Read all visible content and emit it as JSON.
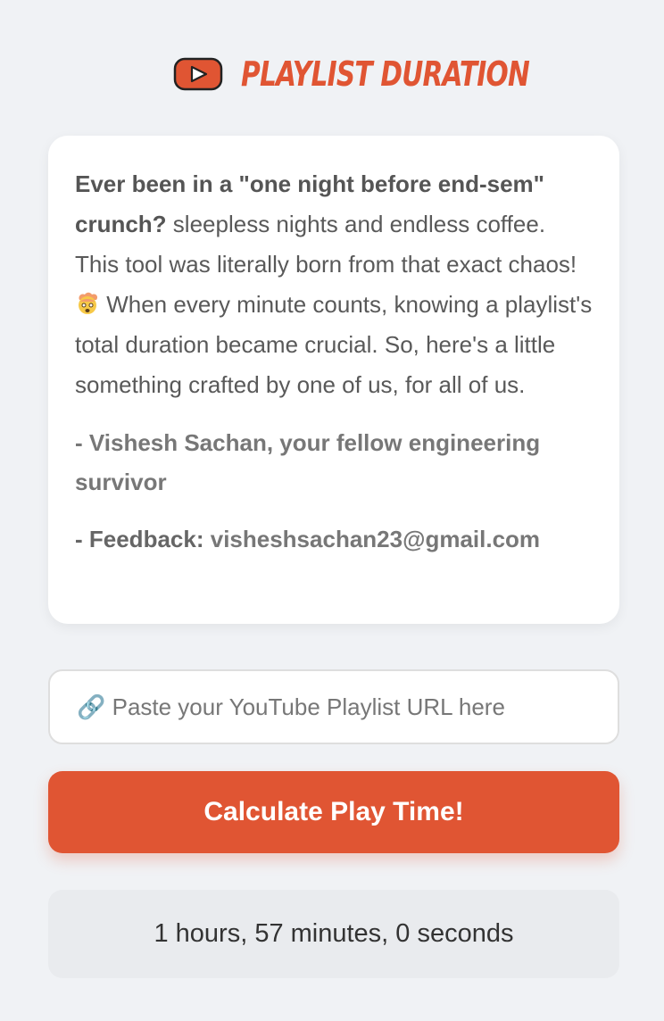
{
  "header": {
    "title": "Playlist Duration",
    "logo_icon": "youtube-play-icon",
    "accent_color": "#e05533"
  },
  "intro": {
    "bold_lead": "Ever been in a \"one night before end-sem\" crunch?",
    "text_before_emoji": " sleepless nights and endless coffee. This tool was literally born from that exact chaos! ",
    "emoji": "exploding-head-emoji",
    "text_after_emoji": " When every minute counts, knowing a playlist's total duration became crucial. So, here's a little something crafted by one of us, for all of us."
  },
  "signature": "- Vishesh Sachan, your fellow engineering survivor",
  "feedback": {
    "label": "- Feedback:",
    "email": "visheshsachan23@gmail.com"
  },
  "url_input": {
    "placeholder": "🔗 Paste your YouTube Playlist URL here",
    "value": ""
  },
  "calculate_button": {
    "label": "Calculate Play Time!"
  },
  "result": {
    "text": "1 hours, 57 minutes, 0 seconds"
  }
}
